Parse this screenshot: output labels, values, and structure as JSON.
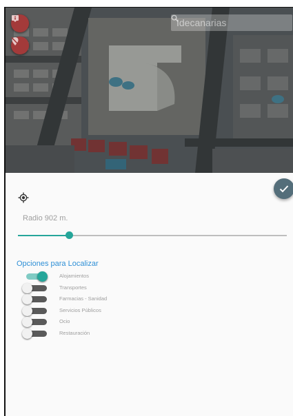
{
  "map": {
    "search_placeholder": "Idecanarias",
    "info_button_icon": "info-marker-icon",
    "no_location_button_icon": "location-off-icon"
  },
  "panel": {
    "locate_icon": "my-location-icon",
    "confirm_icon": "check-icon",
    "radius_label": "Radio 902 m.",
    "radius_slider_fraction": 0.19,
    "section_title": "Opciones para Localizar",
    "options": [
      {
        "label": "Alojamientos",
        "enabled": true
      },
      {
        "label": "Transportes",
        "enabled": false
      },
      {
        "label": "Farmacias - Sanidad",
        "enabled": false
      },
      {
        "label": "Servicios Públicos",
        "enabled": false
      },
      {
        "label": "Ocio",
        "enabled": false
      },
      {
        "label": "Restauración",
        "enabled": false
      }
    ]
  },
  "colors": {
    "accent": "#26a69a",
    "accent_light": "#80cbc4",
    "section_title": "#2e8fd6",
    "confirm_fab": "#546e7a",
    "map_fab": "#a33a3a"
  }
}
